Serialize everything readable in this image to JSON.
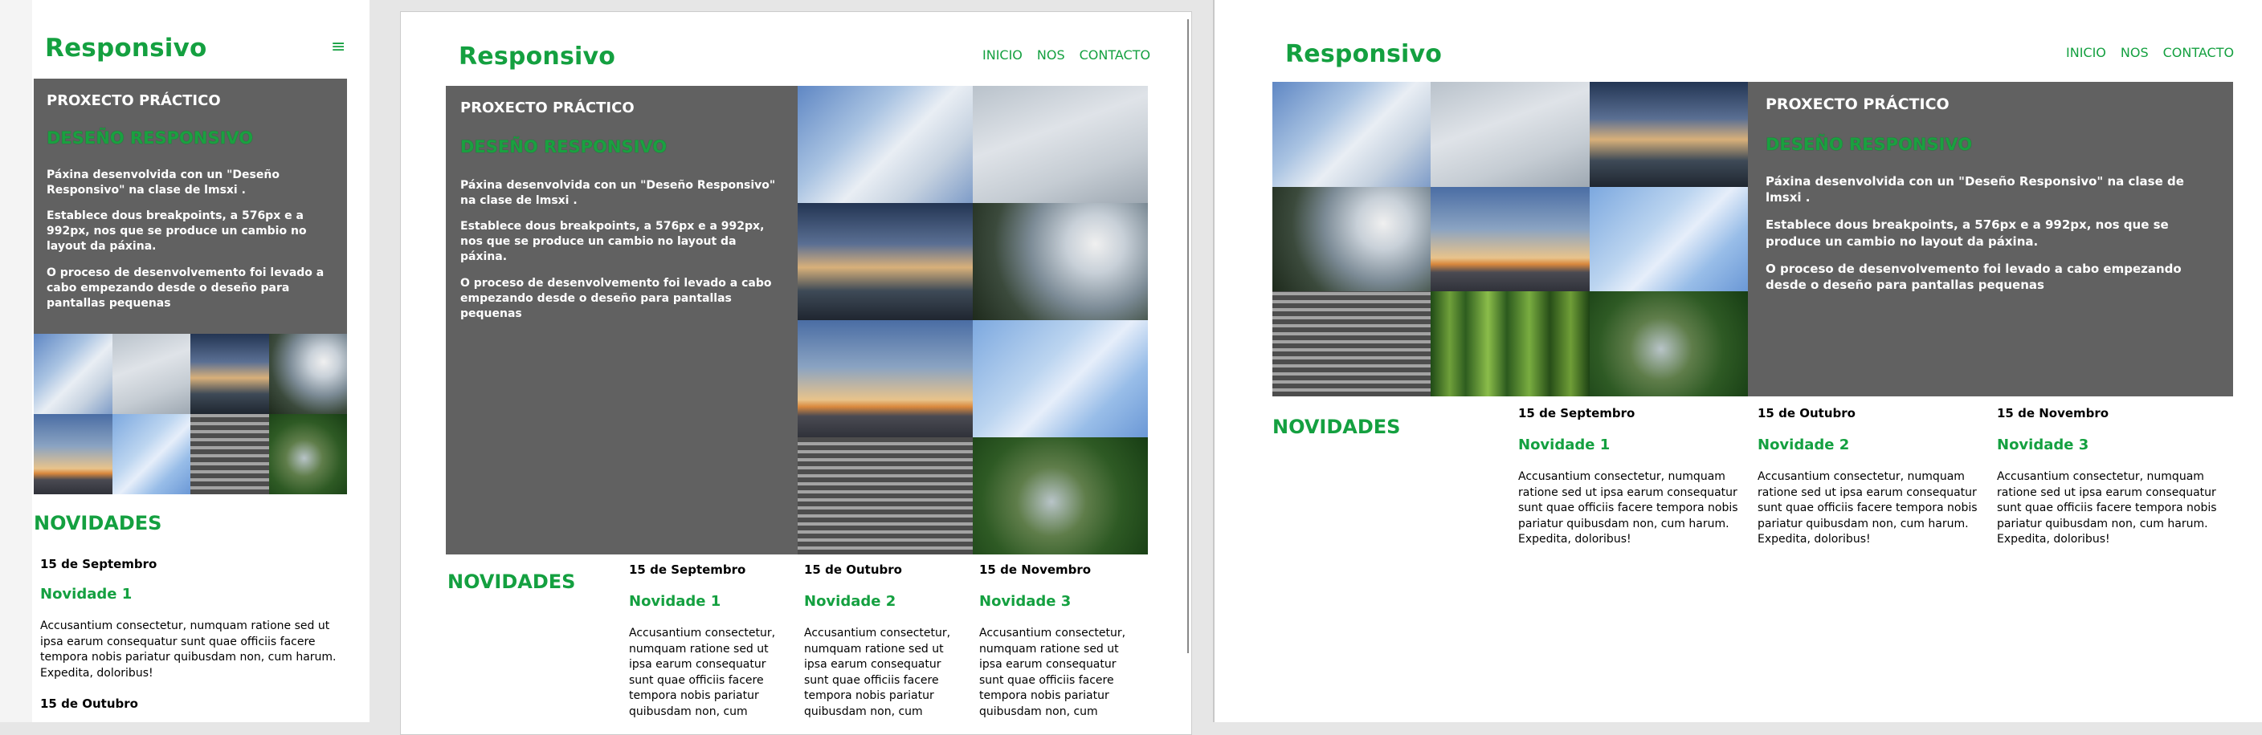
{
  "brand": "Responsivo",
  "nav": [
    "INICIO",
    "NOS",
    "CONTACTO"
  ],
  "intro": {
    "kicker": "PROXECTO PRÁCTICO",
    "heading": "DESEÑO RESPONSIVO",
    "p1_mobile": "Páxina desenvolvida con un \"Deseño Responsivo\" na clase de lmsxi .",
    "p1": "Páxina desenvolvida con un \"Deseño Responsivo\" na clase de lmsxi .",
    "p2": "Establece dous breakpoints, a 576px e a 992px, nos que se produce un cambio no layout da páxina.",
    "p3": "O proceso de desenvolvemento foi levado a cabo empezando desde o deseño para pantallas pequenas"
  },
  "novidades": {
    "title": "NOVIDADES",
    "items": [
      {
        "date": "15 de Septembro",
        "title": "Novidade 1",
        "body": "Accusantium consectetur, numquam ratione sed ut ipsa earum consequatur sunt quae officiis facere tempora nobis pariatur quibusdam non, cum harum. Expedita, doloribus!"
      },
      {
        "date": "15 de Outubro",
        "title": "Novidade 2",
        "body": "Accusantium consectetur, numquam ratione sed ut ipsa earum consequatur sunt quae officiis facere tempora nobis pariatur quibusdam non, cum harum. Expedita, doloribus!"
      },
      {
        "date": "15 de Novembro",
        "title": "Novidade 3",
        "body": "Accusantium consectetur, numquam ratione sed ut ipsa earum consequatur sunt quae officiis facere tempora nobis pariatur quibusdam non, cum harum. Expedita, doloribus!"
      }
    ],
    "tablet_body_cut": "Accusantium consectetur, numquam ratione sed ut ipsa earum consequatur sunt quae officiis facere tempora nobis pariatur quibusdam non, cum"
  },
  "images": [
    "sky1",
    "sky2",
    "dusk",
    "tree",
    "sunset",
    "trails",
    "steps",
    "garden",
    "forest"
  ],
  "colors": {
    "brand": "#14a040",
    "intro_bg": "#616161"
  }
}
